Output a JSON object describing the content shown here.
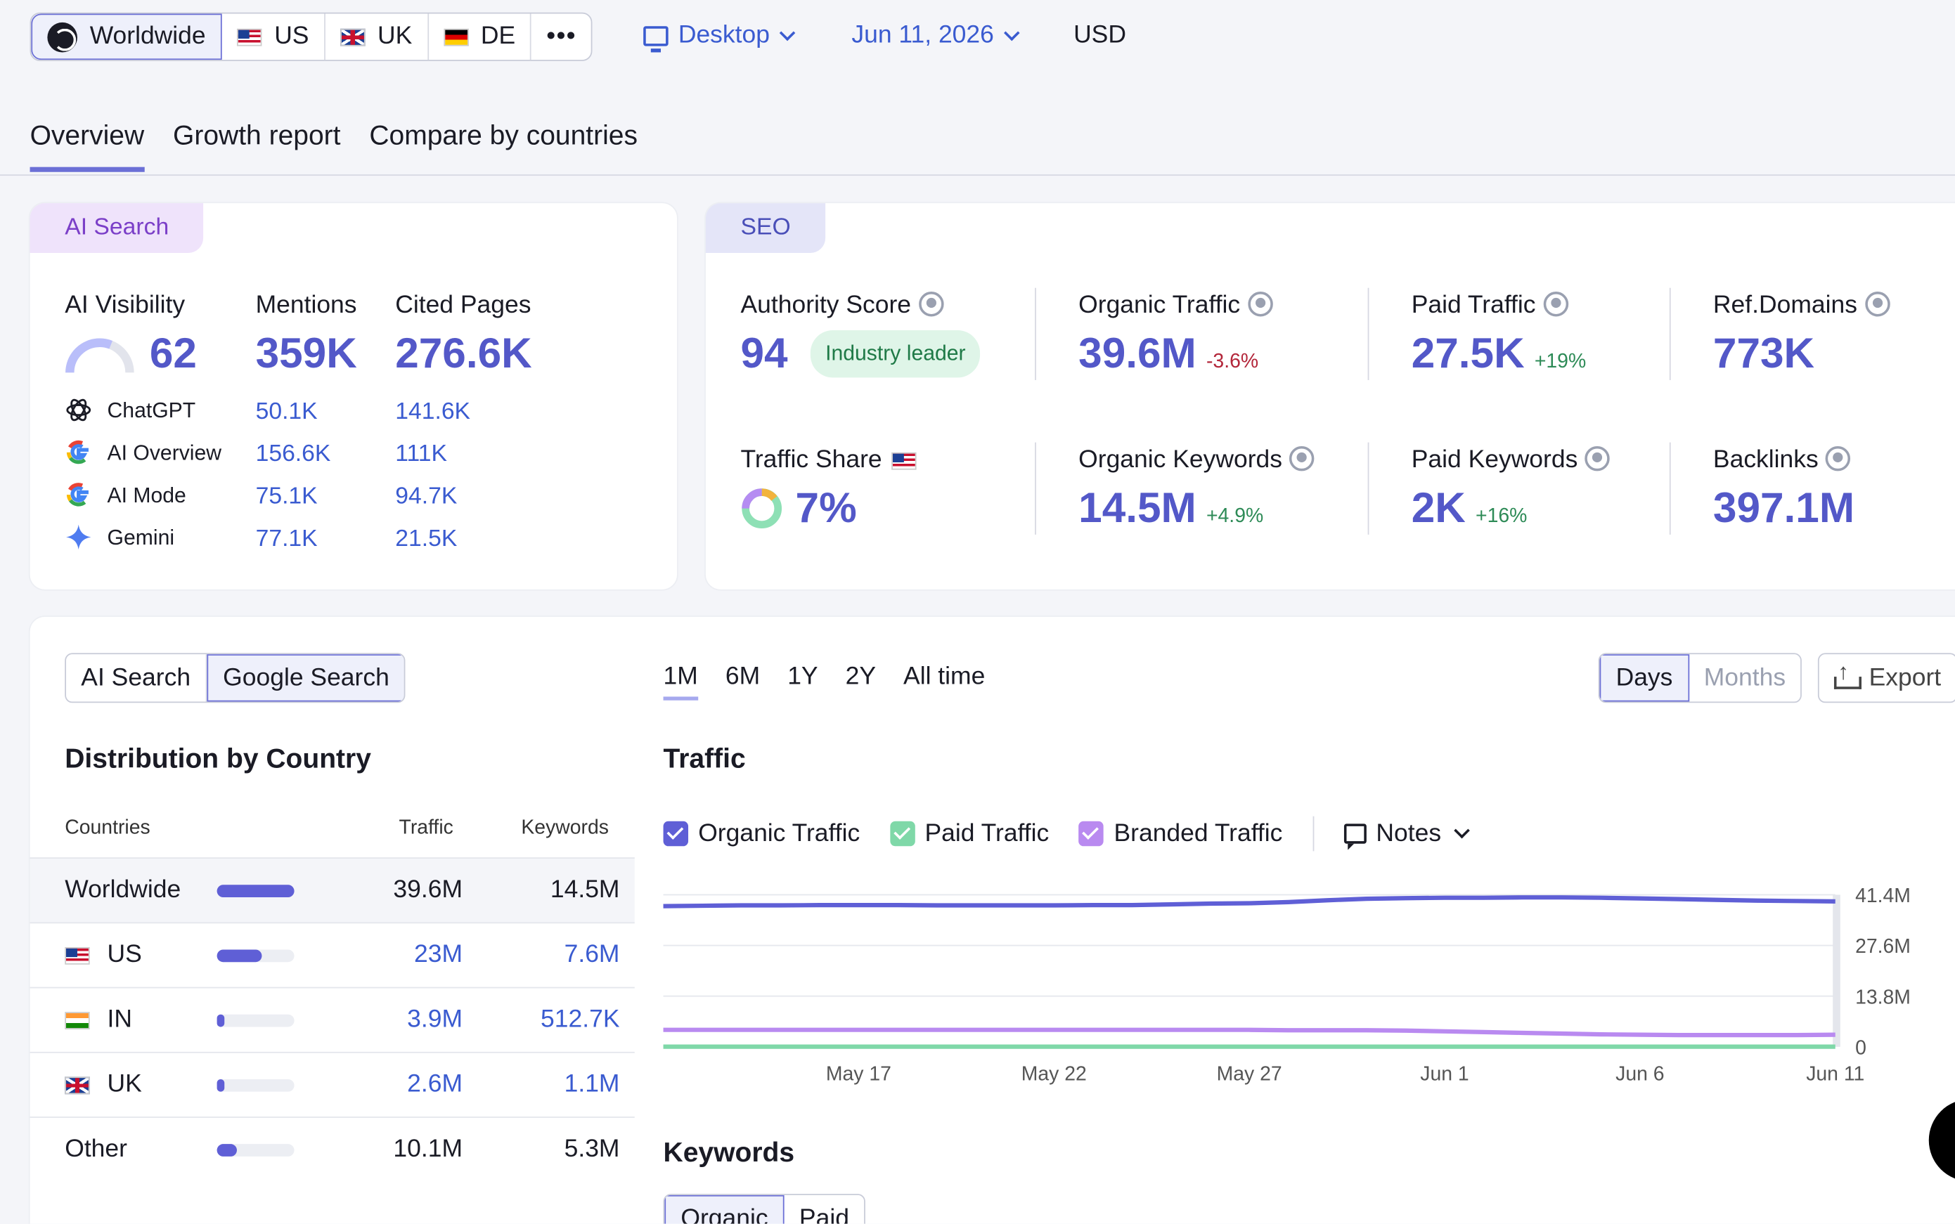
{
  "top": {
    "countries": [
      {
        "label": "Worldwide"
      },
      {
        "label": "US"
      },
      {
        "label": "UK"
      },
      {
        "label": "DE"
      }
    ],
    "more": "•••",
    "device": "Desktop",
    "date": "Jun 11, 2026",
    "currency": "USD"
  },
  "tabs": [
    "Overview",
    "Growth report",
    "Compare by countries"
  ],
  "ai_card": {
    "tag": "AI Search",
    "headers": {
      "visibility": "AI Visibility",
      "mentions": "Mentions",
      "cited": "Cited Pages"
    },
    "visibility": "62",
    "visibility_level": 0.62,
    "mentions": "359K",
    "cited": "276.6K",
    "rows": [
      {
        "name": "ChatGPT",
        "mentions": "50.1K",
        "cited": "141.6K"
      },
      {
        "name": "AI Overview",
        "mentions": "156.6K",
        "cited": "111K"
      },
      {
        "name": "AI Mode",
        "mentions": "75.1K",
        "cited": "94.7K"
      },
      {
        "name": "Gemini",
        "mentions": "77.1K",
        "cited": "21.5K"
      }
    ]
  },
  "seo_card": {
    "tag": "SEO",
    "authority": {
      "label": "Authority Score",
      "value": "94",
      "badge": "Industry leader"
    },
    "organic_traffic": {
      "label": "Organic Traffic",
      "value": "39.6M",
      "change": "-3.6%"
    },
    "paid_traffic": {
      "label": "Paid Traffic",
      "value": "27.5K",
      "change": "+19%"
    },
    "ref_domains": {
      "label": "Ref.Domains",
      "value": "773K"
    },
    "traffic_share": {
      "label": "Traffic Share",
      "value": "7%"
    },
    "organic_keywords": {
      "label": "Organic Keywords",
      "value": "14.5M",
      "change": "+4.9%"
    },
    "paid_keywords": {
      "label": "Paid Keywords",
      "value": "2K",
      "change": "+16%"
    },
    "backlinks": {
      "label": "Backlinks",
      "value": "397.1M"
    }
  },
  "dist": {
    "toggle": [
      "AI Search",
      "Google Search"
    ],
    "title": "Distribution by Country",
    "headers": {
      "country": "Countries",
      "traffic": "Traffic",
      "keywords": "Keywords"
    },
    "rows": [
      {
        "country": "Worldwide",
        "traffic": "39.6M",
        "keywords": "14.5M",
        "share": 1.0
      },
      {
        "country": "US",
        "traffic": "23M",
        "keywords": "7.6M",
        "share": 0.58
      },
      {
        "country": "IN",
        "traffic": "3.9M",
        "keywords": "512.7K",
        "share": 0.1
      },
      {
        "country": "UK",
        "traffic": "2.6M",
        "keywords": "1.1M",
        "share": 0.066
      },
      {
        "country": "Other",
        "traffic": "10.1M",
        "keywords": "5.3M",
        "share": 0.26
      }
    ]
  },
  "traffic_panel": {
    "ranges": [
      "1M",
      "6M",
      "1Y",
      "2Y",
      "All time"
    ],
    "granularity": [
      "Days",
      "Months"
    ],
    "export": "Export",
    "title": "Traffic",
    "legend": [
      {
        "label": "Organic Traffic",
        "color": "#5f5fd6"
      },
      {
        "label": "Paid Traffic",
        "color": "#7fd8a8"
      },
      {
        "label": "Branded Traffic",
        "color": "#b98af0"
      }
    ],
    "notes": "Notes",
    "keywords_title": "Keywords",
    "keywords_tabs": [
      "Organic",
      "Paid"
    ]
  },
  "chart_data": {
    "type": "line",
    "x": [
      "May 12",
      "May 13",
      "May 14",
      "May 15",
      "May 16",
      "May 17",
      "May 18",
      "May 19",
      "May 20",
      "May 21",
      "May 22",
      "May 23",
      "May 24",
      "May 25",
      "May 26",
      "May 27",
      "May 28",
      "May 29",
      "May 30",
      "May 31",
      "Jun 1",
      "Jun 2",
      "Jun 3",
      "Jun 4",
      "Jun 5",
      "Jun 6",
      "Jun 7",
      "Jun 8",
      "Jun 9",
      "Jun 10",
      "Jun 11"
    ],
    "x_ticks": [
      "May 17",
      "May 22",
      "May 27",
      "Jun 1",
      "Jun 6",
      "Jun 11"
    ],
    "y_ticks": [
      "41.4M",
      "27.6M",
      "13.8M",
      "0"
    ],
    "ylim": [
      0,
      41.4
    ],
    "series": [
      {
        "name": "Organic Traffic",
        "color": "#5f5fd6",
        "values": [
          38.3,
          38.4,
          38.5,
          38.5,
          38.6,
          38.6,
          38.6,
          38.5,
          38.5,
          38.5,
          38.5,
          38.6,
          38.6,
          38.8,
          39.0,
          39.1,
          39.4,
          39.9,
          40.3,
          40.5,
          40.6,
          40.6,
          40.7,
          40.7,
          40.6,
          40.4,
          40.2,
          40.0,
          39.8,
          39.7,
          39.6
        ]
      },
      {
        "name": "Branded Traffic",
        "color": "#b98af0",
        "values": [
          4.6,
          4.6,
          4.6,
          4.6,
          4.6,
          4.6,
          4.6,
          4.6,
          4.6,
          4.6,
          4.6,
          4.6,
          4.6,
          4.6,
          4.6,
          4.6,
          4.5,
          4.5,
          4.5,
          4.4,
          4.2,
          4.0,
          3.8,
          3.6,
          3.4,
          3.3,
          3.2,
          3.2,
          3.2,
          3.2,
          3.3
        ]
      },
      {
        "name": "Paid Traffic",
        "color": "#7fd8a8",
        "values": [
          0.03,
          0.03,
          0.03,
          0.03,
          0.03,
          0.03,
          0.03,
          0.03,
          0.03,
          0.03,
          0.03,
          0.03,
          0.03,
          0.03,
          0.03,
          0.03,
          0.03,
          0.03,
          0.03,
          0.03,
          0.03,
          0.03,
          0.03,
          0.03,
          0.03,
          0.03,
          0.03,
          0.03,
          0.03,
          0.03,
          0.03
        ]
      }
    ],
    "grid": true
  }
}
